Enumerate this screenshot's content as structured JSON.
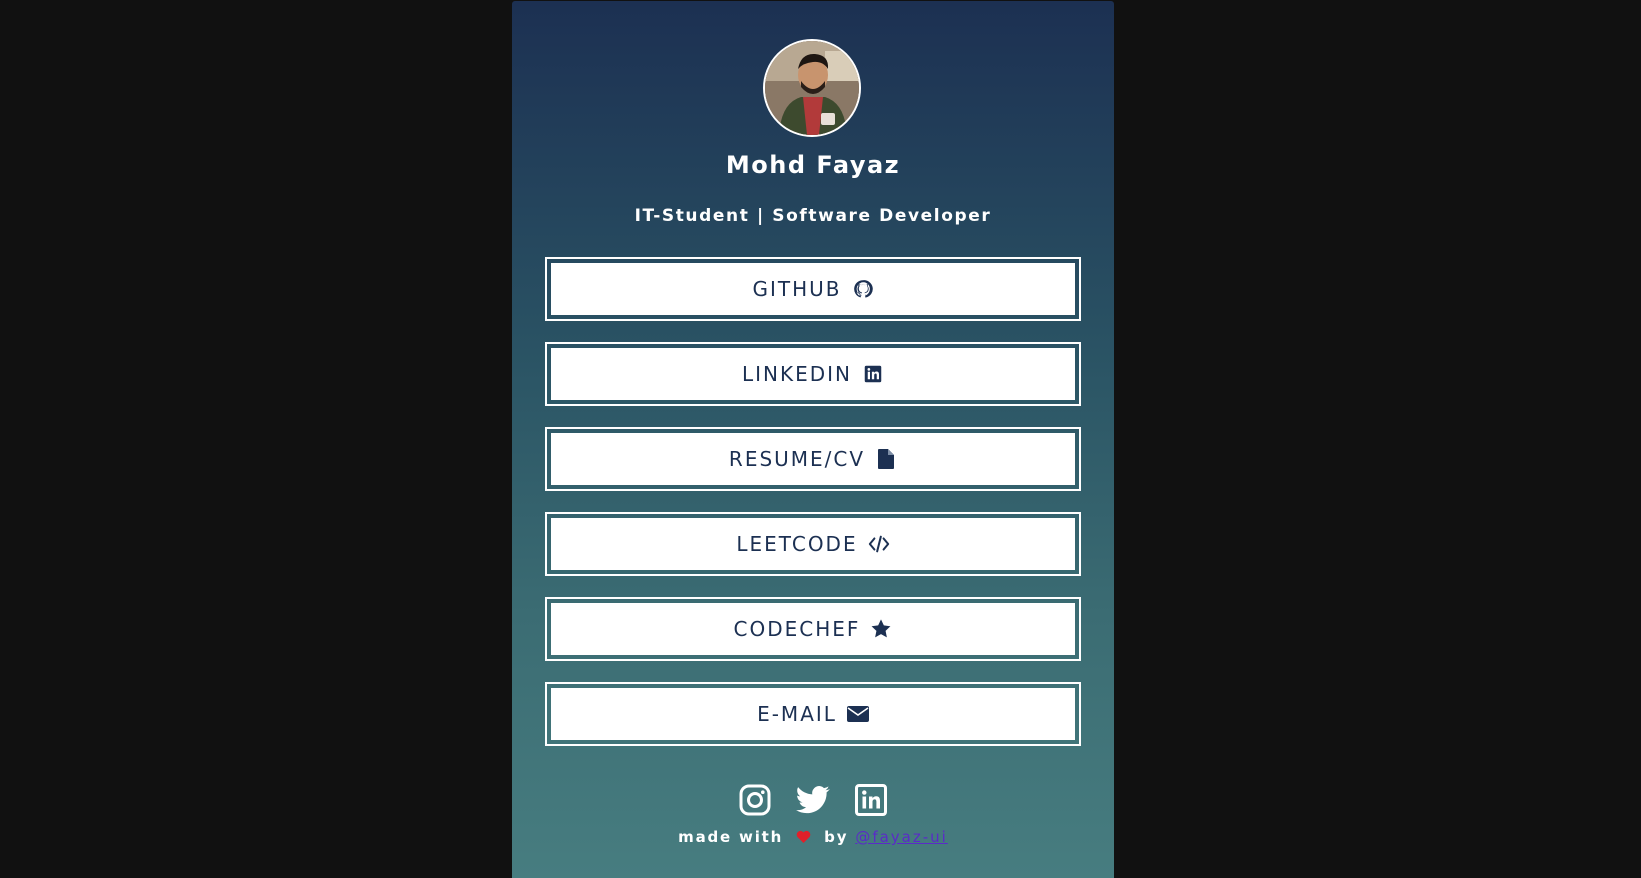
{
  "profile": {
    "name": "Mohd Fayaz",
    "tagline": "IT-Student | Software Developer",
    "avatar_alt": "profile photo"
  },
  "links": [
    {
      "label": "GITHUB",
      "icon": "github-icon"
    },
    {
      "label": "LINKEDIN",
      "icon": "linkedin-icon"
    },
    {
      "label": "RESUME/CV",
      "icon": "file-icon"
    },
    {
      "label": "LEETCODE",
      "icon": "code-icon"
    },
    {
      "label": "CODECHEF",
      "icon": "star-icon"
    },
    {
      "label": "E-MAIL",
      "icon": "envelope-icon"
    }
  ],
  "socials": [
    "instagram-icon",
    "twitter-icon",
    "linkedin-icon"
  ],
  "footer": {
    "made_with": "made with",
    "by": "by",
    "handle": "@fayaz-ui"
  },
  "colors": {
    "page_background": "#111111",
    "card_top": "#1c3052",
    "card_bottom": "#477d80",
    "button_text": "#1c3052",
    "heart": "#e0202a",
    "handle_link": "#5a2bc8"
  }
}
